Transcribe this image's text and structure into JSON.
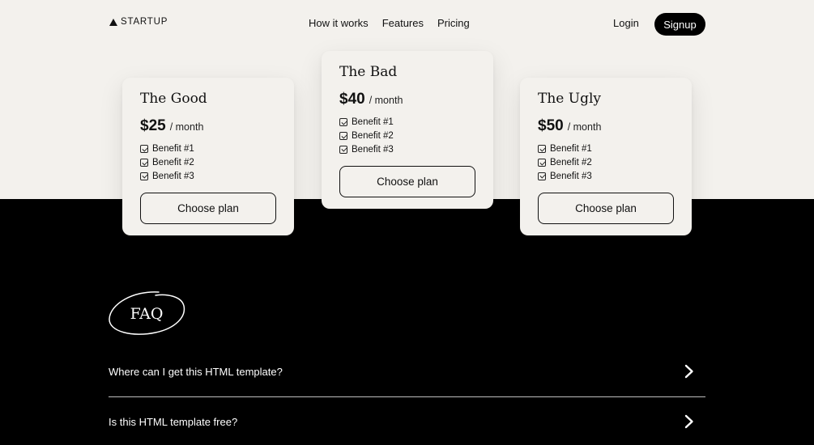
{
  "header": {
    "logo_text": "STARTUP",
    "logo_icon": "triangle-logo-icon",
    "nav": [
      {
        "label": "How it works"
      },
      {
        "label": "Features"
      },
      {
        "label": "Pricing"
      }
    ],
    "login_label": "Login",
    "signup_label": "Signup"
  },
  "plans": [
    {
      "name": "The Good",
      "price": "$25",
      "period": "/ month",
      "benefits": [
        "Benefit #1",
        "Benefit #2",
        "Benefit #3"
      ],
      "button_label": "Choose plan"
    },
    {
      "name": "The Bad",
      "price": "$40",
      "period": "/ month",
      "benefits": [
        "Benefit #1",
        "Benefit #2",
        "Benefit #3"
      ],
      "button_label": "Choose plan"
    },
    {
      "name": "The Ugly",
      "price": "$50",
      "period": "/ month",
      "benefits": [
        "Benefit #1",
        "Benefit #2",
        "Benefit #3"
      ],
      "button_label": "Choose plan"
    }
  ],
  "faq": {
    "title": "FAQ",
    "items": [
      {
        "question": "Where can I get this HTML template?"
      },
      {
        "question": "Is this HTML template free?"
      }
    ]
  },
  "colors": {
    "light_background": "#f3f1ed",
    "dark_background": "#000000",
    "text": "#111111"
  }
}
